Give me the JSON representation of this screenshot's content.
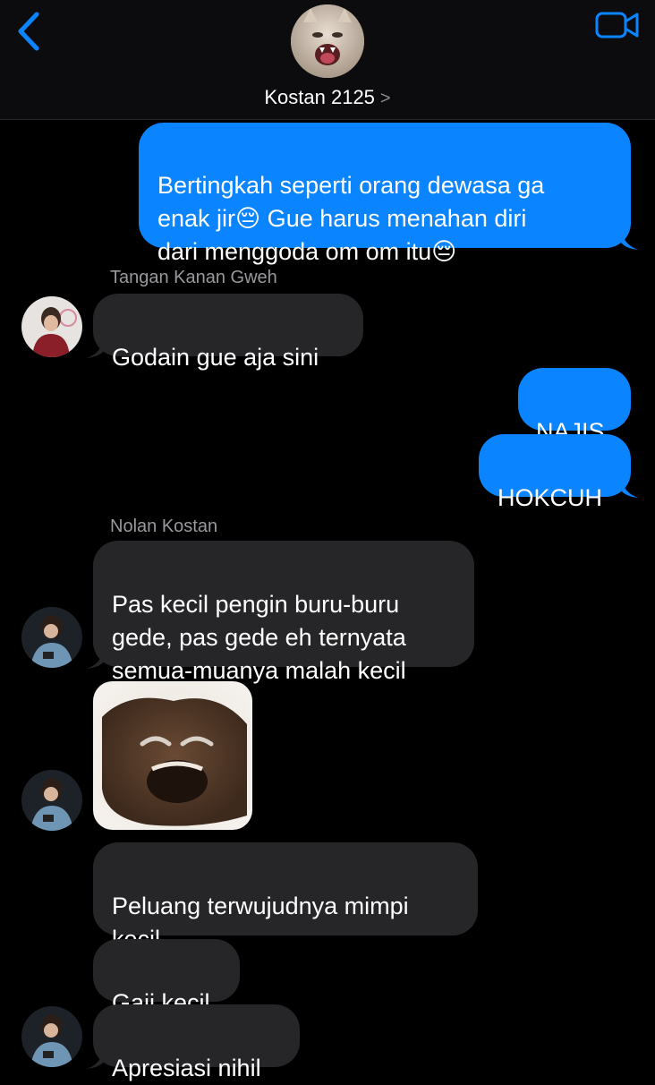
{
  "header": {
    "title": "Kostan 2125",
    "chevron": ">",
    "back_icon": "chevron-left-icon",
    "video_icon": "video-camera-icon",
    "accent": "#0a84ff"
  },
  "messages": {
    "m1": "Bertingkah seperti orang dewasa ga\nenak jir😔 Gue harus menahan diri\ndari menggoda om om itu😔",
    "sender1": "Tangan Kanan Gweh",
    "m2": "Godain gue aja sini",
    "m3": "NAJIS",
    "m4": "HOKCUH",
    "sender2": "Nolan Kostan",
    "m5": "Pas kecil pengin buru-buru\ngede, pas gede eh ternyata\nsemua-muanya malah kecil",
    "m6": "Peluang terwujudnya mimpi\nkecil",
    "m7": "Gaji kecil",
    "m8": "Apresiasi nihil"
  },
  "colors": {
    "sent_bubble": "#0a84ff",
    "received_bubble": "#262629",
    "background": "#000000"
  }
}
